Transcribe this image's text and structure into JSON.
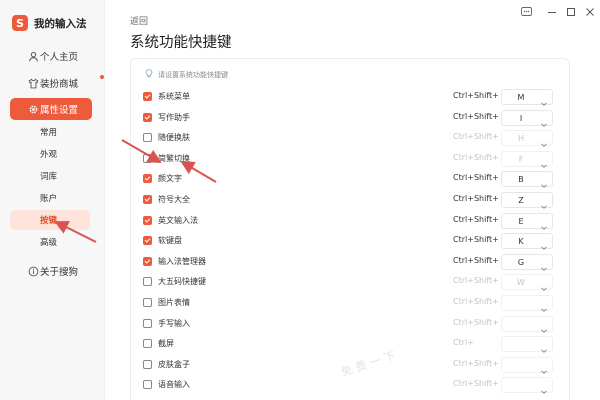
{
  "app": {
    "name": "我的输入法",
    "logo_char": "S"
  },
  "sidebar": {
    "items": [
      {
        "label": "个人主页",
        "icon": "user-icon"
      },
      {
        "label": "装扮商城",
        "icon": "shirt-icon",
        "badge_dot": true
      },
      {
        "label": "属性设置",
        "icon": "gear-icon",
        "active": true
      }
    ],
    "subitems": [
      {
        "label": "常用"
      },
      {
        "label": "外观"
      },
      {
        "label": "词库"
      },
      {
        "label": "账户"
      },
      {
        "label": "按键",
        "active": true
      },
      {
        "label": "高级"
      }
    ],
    "about": {
      "label": "关于搜狗",
      "icon": "info-icon"
    }
  },
  "main": {
    "back_label": "返回",
    "title": "系统功能快捷键",
    "hint": "请设置系统功能快捷键",
    "shortcuts": [
      {
        "name": "系统菜单",
        "checked": true,
        "modifier": "Ctrl+Shift+",
        "key": "M"
      },
      {
        "name": "写作助手",
        "checked": true,
        "modifier": "Ctrl+Shift+",
        "key": "I"
      },
      {
        "name": "随便换肤",
        "checked": false,
        "modifier": "Ctrl+Shift+",
        "key": "H"
      },
      {
        "name": "简繁切换",
        "checked": false,
        "modifier": "Ctrl+Shift+",
        "key": "F"
      },
      {
        "name": "颜文字",
        "checked": true,
        "modifier": "Ctrl+Shift+",
        "key": "B"
      },
      {
        "name": "符号大全",
        "checked": true,
        "modifier": "Ctrl+Shift+",
        "key": "Z"
      },
      {
        "name": "英文输入法",
        "checked": true,
        "modifier": "Ctrl+Shift+",
        "key": "E"
      },
      {
        "name": "软键盘",
        "checked": true,
        "modifier": "Ctrl+Shift+",
        "key": "K"
      },
      {
        "name": "输入法管理器",
        "checked": true,
        "modifier": "Ctrl+Shift+",
        "key": "G"
      },
      {
        "name": "大五码快捷键",
        "checked": false,
        "modifier": "Ctrl+Shift+",
        "key": "W"
      },
      {
        "name": "图片表情",
        "checked": false,
        "modifier": "Ctrl+Shift+",
        "key": ""
      },
      {
        "name": "手写输入",
        "checked": false,
        "modifier": "Ctrl+Shift+",
        "key": ""
      },
      {
        "name": "截屏",
        "checked": false,
        "modifier": "Ctrl+",
        "key": ""
      },
      {
        "name": "皮肤盒子",
        "checked": false,
        "modifier": "Ctrl+Shift+",
        "key": ""
      },
      {
        "name": "语音输入",
        "checked": false,
        "modifier": "Ctrl+Shift+",
        "key": ""
      }
    ]
  },
  "window_controls": [
    "help-icon",
    "minimize-icon",
    "maximize-icon",
    "close-icon"
  ],
  "colors": {
    "accent": "#ee5b3c",
    "accent_light": "#fde3d9",
    "annotation": "#d9534f"
  }
}
